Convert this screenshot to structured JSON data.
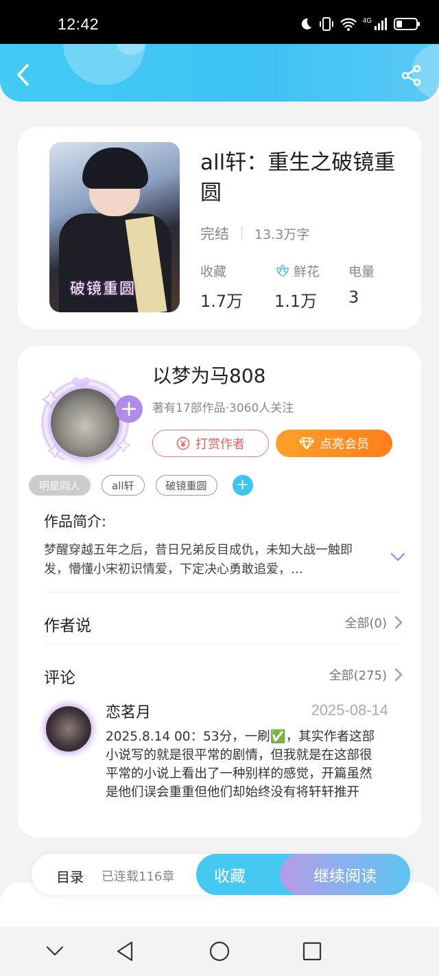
{
  "status_bar": {
    "time": "12:42",
    "network": "4G"
  },
  "book": {
    "title": "all轩：重生之破镜重圆",
    "cover_text": "破镜重圆",
    "status": "完结",
    "word_count": "13.3万字",
    "stats": [
      {
        "label": "收藏",
        "value": "1.7万",
        "icon": null
      },
      {
        "label": "鲜花",
        "value": "1.1万",
        "icon": "flower-icon"
      },
      {
        "label": "电量",
        "value": "3",
        "icon": null
      }
    ]
  },
  "author": {
    "name": "以梦为马808",
    "info": "著有17部作品·3060人关注",
    "follow_icon": "+",
    "tip_label": "打赏作者",
    "vip_label": "点亮会员"
  },
  "tags": [
    "明星同人",
    "all轩",
    "破镜重圆"
  ],
  "intro": {
    "label": "作品简介:",
    "text": "梦醒穿越五年之后，昔日兄弟反目成仇，未知大战一触即发，懵懂小宋初识情爱，下定决心勇敢追爱，…"
  },
  "author_says": {
    "label": "作者说",
    "link": "全部(0)"
  },
  "comments": {
    "label": "评论",
    "link": "全部(275)",
    "items": [
      {
        "user": "恋茗月",
        "date": "2025-08-14",
        "text": "2025.8.14  00：53分，一刷✅，其实作者这部小说写的就是很平常的剧情，但我就是在这部很平常的小说上看出了一种别样的感觉，开篇虽然是他们误会重重但他们却始终没有将轩轩推开"
      }
    ]
  },
  "bottom_bar": {
    "toc_label": "目录",
    "chapter_count": "已连载116章",
    "collect_label": "收藏",
    "read_label": "继续阅读"
  },
  "colors": {
    "header": "#43cbf4",
    "accent_purple": "#b08ce8",
    "tip_red": "#ec5d5d",
    "vip_orange": "#ff8f22"
  }
}
